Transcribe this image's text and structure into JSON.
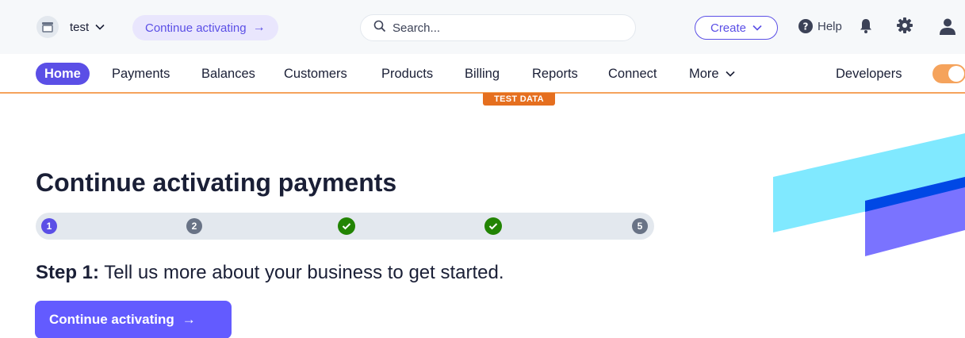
{
  "account": {
    "name": "test",
    "icon": "store-icon"
  },
  "topbar": {
    "continue_pill": "Continue activating",
    "continue_arrow": "→",
    "search_placeholder": "Search...",
    "create_label": "Create",
    "help_label": "Help"
  },
  "nav": {
    "items": [
      "Home",
      "Payments",
      "Balances",
      "Customers",
      "Products",
      "Billing",
      "Reports",
      "Connect",
      "More"
    ],
    "developers": "Developers",
    "test_mode_on": true
  },
  "badge": "TEST DATA",
  "main": {
    "title": "Continue activating payments",
    "steps": [
      {
        "label": "1",
        "state": "active"
      },
      {
        "label": "2",
        "state": "todo"
      },
      {
        "label": "",
        "state": "done"
      },
      {
        "label": "",
        "state": "done"
      },
      {
        "label": "5",
        "state": "todo"
      }
    ],
    "step_prefix": "Step 1:",
    "step_text": " Tell us more about your business to get started.",
    "cta_label": "Continue activating",
    "cta_arrow": "→"
  },
  "colors": {
    "accent": "#635bff",
    "test_orange": "#e56f1f",
    "success": "#228403"
  }
}
